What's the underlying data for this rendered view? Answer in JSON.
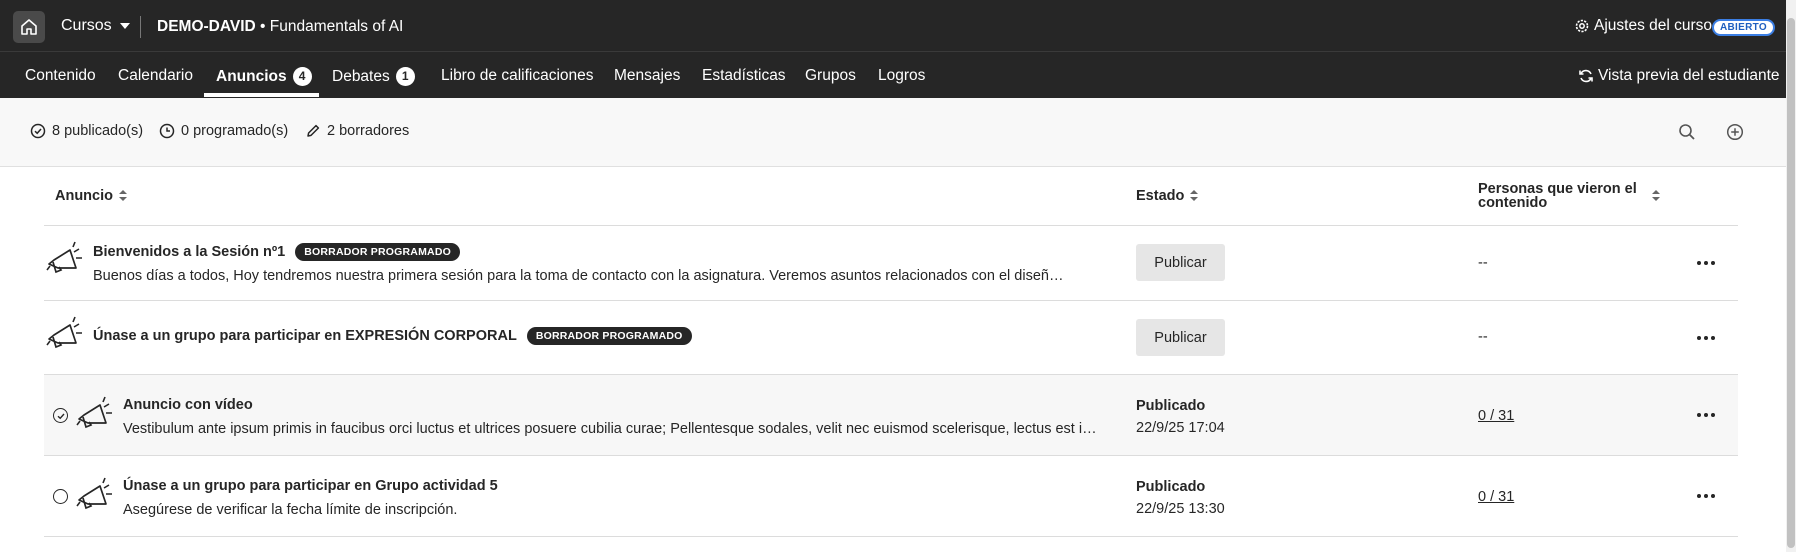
{
  "header": {
    "courses_menu": "Cursos",
    "course_code": "DEMO-DAVID",
    "course_separator": " • ",
    "course_name": "Fundamentals of AI",
    "settings_label": "Ajustes del curso",
    "status_badge": "ABIERTO"
  },
  "nav": {
    "tabs": [
      {
        "label": "Contenido"
      },
      {
        "label": "Calendario"
      },
      {
        "label": "Anuncios",
        "count": "4"
      },
      {
        "label": "Debates",
        "count": "1"
      },
      {
        "label": "Libro de calificaciones"
      },
      {
        "label": "Mensajes"
      },
      {
        "label": "Estadísticas"
      },
      {
        "label": "Grupos"
      },
      {
        "label": "Logros"
      }
    ],
    "active_tab": "Anuncios",
    "student_preview": "Vista previa del estudiante"
  },
  "status": {
    "published": "8 publicado(s)",
    "scheduled": "0 programado(s)",
    "drafts": "2 borradores"
  },
  "table": {
    "columns": {
      "announcement": "Anuncio",
      "state": "Estado",
      "viewers": "Personas que vieron el contenido"
    },
    "rows": [
      {
        "title": "Bienvenidos a la Sesión nº1",
        "badge": "BORRADOR PROGRAMADO",
        "description": "Buenos días a todos, Hoy tendremos nuestra primera sesión para la toma de contacto con la asignatura. Veremos asuntos relacionados con el diseñ…",
        "action": "Publicar",
        "viewers": "--"
      },
      {
        "title": "Únase a un grupo para participar en EXPRESIÓN CORPORAL",
        "badge": "BORRADOR PROGRAMADO",
        "action": "Publicar",
        "viewers": "--"
      },
      {
        "title": "Anuncio con vídeo",
        "description": "Vestibulum ante ipsum primis in faucibus orci luctus et ultrices posuere cubilia curae; Pellentesque sodales, velit nec euismod scelerisque, lectus est i…",
        "state": "Publicado",
        "date": "22/9/25 17:04",
        "viewers": "0 / 31",
        "selected": true
      },
      {
        "title": "Únase a un grupo para participar en Grupo actividad 5",
        "description": "Asegúrese de verificar la fecha límite de inscripción.",
        "state": "Publicado",
        "date": "22/9/25 13:30",
        "viewers": "0 / 31",
        "selected": false
      }
    ]
  },
  "icons": [
    "home-icon",
    "caret-down-icon",
    "gear-icon",
    "refresh-icon",
    "check-circle-icon",
    "clock-icon",
    "pencil-icon",
    "search-icon",
    "add-circle-icon",
    "megaphone-icon",
    "more-icon"
  ]
}
